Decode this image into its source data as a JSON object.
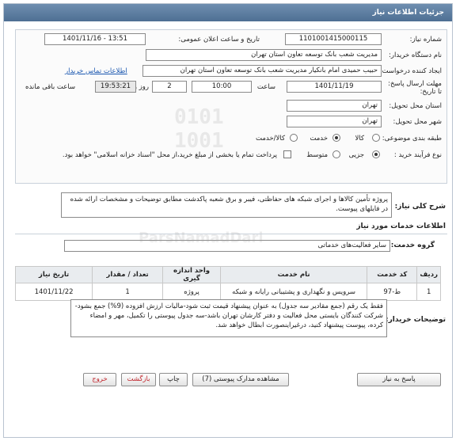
{
  "header": {
    "title": "جزئیات اطلاعات نیاز"
  },
  "form": {
    "need_number": {
      "label": "شماره نیاز:",
      "value": "1101001415000115"
    },
    "announce": {
      "label": "تاریخ و ساعت اعلان عمومی:",
      "value": "1401/11/16 - 13:51"
    },
    "buyer_org": {
      "label": "نام دستگاه خریدار:",
      "value": "مدیریت شعب بانک توسعه تعاون استان تهران"
    },
    "creator": {
      "label": "ایجاد کننده درخواست:",
      "value": "حبیب حمیدی امام بانکیار مدیریت شعب بانک توسعه تعاون استان تهران",
      "contact_link": "اطلاعات تماس خریدار"
    },
    "deadline": {
      "label": "مهلت ارسال پاسخ: تا تاریخ:",
      "date": "1401/11/19",
      "time_label": "ساعت",
      "time": "10:00",
      "days": "2",
      "days_label": "روز و",
      "remaining": "19:53:21",
      "remaining_label": "ساعت باقی مانده"
    },
    "province": {
      "label": "استان محل تحویل:",
      "value": "تهران"
    },
    "city": {
      "label": "شهر محل تحویل:",
      "value": "تهران"
    },
    "category": {
      "label": "طبقه بندی موضوعی:",
      "options": [
        "کالا",
        "خدمت",
        "کالا/خدمت"
      ],
      "selected": "خدمت"
    },
    "process": {
      "label": "نوع فرآیند خرید :",
      "options": [
        "جزیی",
        "متوسط"
      ],
      "selected": "جزیی",
      "note": "پرداخت تمام یا بخشی از مبلغ خرید،از محل \"اسناد خزانه اسلامی\" خواهد بود."
    }
  },
  "need_summary": {
    "label": "شرح کلی نیاز:",
    "text": "پروژه تأمین کالاها و اجرای شبکه های حفاظتی، فیبر و برق شعبه پاکدشت مطابق توضیحات و مشخصات ارائه شده در فایلهای پیوست."
  },
  "services": {
    "section_title": "اطلاعات خدمات مورد نیاز",
    "group_label": "گروه خدمت:",
    "group_value": "سایر فعالیت‌های خدماتی",
    "columns": [
      "ردیف",
      "کد خدمت",
      "نام خدمت",
      "واحد اندازه گیری",
      "تعداد / مقدار",
      "تاریخ نیاز"
    ],
    "rows": [
      [
        "1",
        "ط-97",
        "سرویس و نگهداری و پشتیبانی رایانه و شبکه",
        "پروژه",
        "1",
        "1401/11/22"
      ]
    ]
  },
  "buyer_notes": {
    "label": "توضیحات خریدار:",
    "text": "فقط یک رقم (جمع مقادیر سه جدول) به عنوان پیشنهاد قیمت ثبت شود-مالیات ارزش افزوده (9%) جمع بشود-شرکت کنندگان بایستی محل فعالیت و دفتر کارشان تهران باشد-سه جدول پیوستی را تکمیل، مهر و امضاء کرده، پیوست پیشنهاد کنید، درغیراینصورت ابطال خواهد شد."
  },
  "buttons": {
    "reply": "پاسخ به نیاز",
    "attachments": "مشاهده مدارک پیوستی (7)",
    "print": "چاپ",
    "back": "بازگشت",
    "exit": "خروج"
  },
  "colors": {
    "header": "#5a7a9c",
    "link": "#1a57b0",
    "exit": "#c0262d"
  }
}
